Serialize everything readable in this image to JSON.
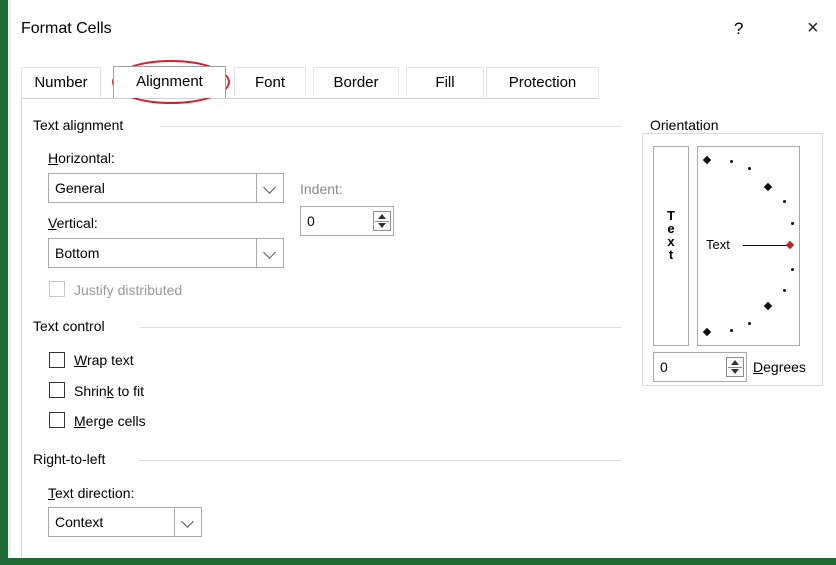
{
  "window": {
    "title": "Format Cells",
    "help": "?",
    "close": "×"
  },
  "tabs": [
    {
      "label": "Number"
    },
    {
      "label": "Alignment"
    },
    {
      "label": "Font"
    },
    {
      "label": "Border"
    },
    {
      "label": "Fill"
    },
    {
      "label": "Protection"
    }
  ],
  "active_tab": "Alignment",
  "text_alignment": {
    "group_title": "Text alignment",
    "horizontal_label": "Horizontal:",
    "horizontal_value": "General",
    "indent_label": "Indent:",
    "indent_value": "0",
    "vertical_label": "Vertical:",
    "vertical_value": "Bottom",
    "justify_label": "Justify distributed"
  },
  "text_control": {
    "group_title": "Text control",
    "wrap": "Wrap text",
    "shrink": "Shrink to fit",
    "merge": "Merge cells"
  },
  "rtl": {
    "group_title": "Right-to-left",
    "direction_label": "Text direction:",
    "direction_value": "Context"
  },
  "orientation": {
    "group_title": "Orientation",
    "vertical_text": [
      "T",
      "e",
      "x",
      "t"
    ],
    "dial_text": "Text",
    "degrees_value": "0",
    "degrees_label": "Degrees"
  },
  "colors": {
    "accent_green": "#1e6b33",
    "highlight_red": "#d61f2b",
    "dial_marker_red": "#c0252b"
  }
}
